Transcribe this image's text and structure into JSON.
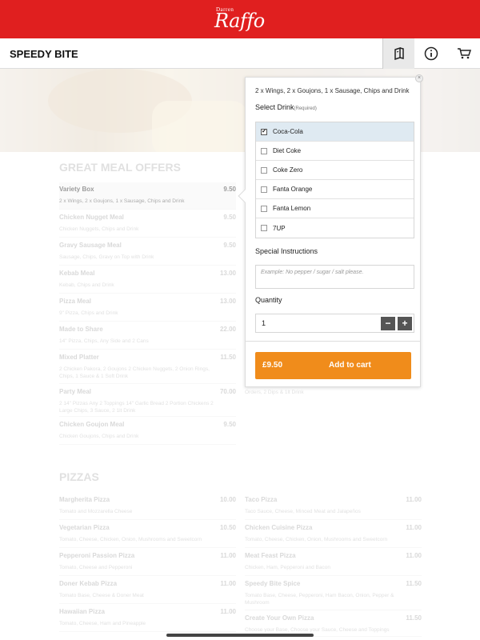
{
  "brand": {
    "small": "Darren",
    "name": "Raffo"
  },
  "navbar": {
    "title": "SPEEDY BITE"
  },
  "sections": {
    "meal_offers": {
      "title": "GREAT MEAL OFFERS",
      "items": [
        {
          "name": "Variety Box",
          "price": "9.50",
          "desc": "2 x Wings, 2 x Goujons, 1 x Sausage, Chips and Drink"
        },
        {
          "name": "Chicken Nugget Meal",
          "price": "9.50",
          "desc": "Chicken Nuggets, Chips and Drink"
        },
        {
          "name": "Gravy Sausage Meal",
          "price": "9.50",
          "desc": "Sausage, Chips, Gravy on Top with Drink"
        },
        {
          "name": "Kebab Meal",
          "price": "13.00",
          "desc": "Kebab, Chips and Drink"
        },
        {
          "name": "Pizza Meal",
          "price": "13.00",
          "desc": "9\" Pizza, Chips and Drink"
        },
        {
          "name": "Made to Share",
          "price": "22.00",
          "desc": "14\" Pizza, Chips, Any Side and 2 Cans"
        },
        {
          "name": "Mixed Platter",
          "price": "11.50",
          "desc": "2 Chicken Pakora, 2 Goujons 2 Chicken Nuggets, 2 Onion Rings, Chips, 1 Sauce & 1 Soft Drink"
        },
        {
          "name": "Party Meal",
          "price": "70.00",
          "desc": "2 14\" Pizzas Any 2 Toppings 14\" Garlic Bread 2 Portion Chickens 2 Large Chips, 3 Sauce, 2 1lt Drink"
        },
        {
          "name": "Chicken Goujon Meal",
          "price": "9.50",
          "desc": "Chicken Goujons, Chips and Drink"
        }
      ],
      "right_fragment": "Orders, 2 Dips & 1lt Drink"
    },
    "pizzas": {
      "title": "PIZZAS",
      "left": [
        {
          "name": "Margherita Pizza",
          "price": "10.00",
          "desc": "Tomato and Mozzarella Cheese"
        },
        {
          "name": "Vegetarian Pizza",
          "price": "10.50",
          "desc": "Tomato, Cheese, Chicken, Onion, Mushrooms and Sweetcorn"
        },
        {
          "name": "Pepperoni Passion Pizza",
          "price": "11.00",
          "desc": "Tomato, Cheese and Pepperoni"
        },
        {
          "name": "Doner Kebab Pizza",
          "price": "11.00",
          "desc": "Tomato Base, Cheese & Doner Meat"
        },
        {
          "name": "Hawaiian Pizza",
          "price": "11.00",
          "desc": "Tomato, Cheese, Ham and Pineapple"
        }
      ],
      "right": [
        {
          "name": "Taco Pizza",
          "price": "11.00",
          "desc": "Taco Sauce, Cheese, Minced Meat and Jalapeños"
        },
        {
          "name": "Chicken Cuisine Pizza",
          "price": "11.00",
          "desc": "Tomato, Cheese, Chicken, Onion, Mushrooms and Sweetcorn"
        },
        {
          "name": "Meat Feast Pizza",
          "price": "11.00",
          "desc": "Chicken, Ham, Pepperoni and Bacon"
        },
        {
          "name": "Speedy Bite Spice",
          "price": "11.50",
          "desc": "Tomato Base, Cheese, Pepperoni, Ham Bacon, Onion, Pepper & Mushroom"
        },
        {
          "name": "Create Your Own Pizza",
          "price": "11.50",
          "desc": "Choose your Base, Choose your Sauce, Cheese and Toppings"
        }
      ]
    }
  },
  "popup": {
    "description": "2 x Wings, 2 x Goujons, 1 x Sausage, Chips and Drink",
    "drink_label": "Select Drink",
    "required": "(Required)",
    "drinks": [
      "Coca-Cola",
      "Diet Coke",
      "Coke Zero",
      "Fanta Orange",
      "Fanta Lemon",
      "7UP"
    ],
    "selected_drink": "Coca-Cola",
    "special_label": "Special Instructions",
    "special_placeholder": "Example: No pepper / sugar / salt please.",
    "quantity_label": "Quantity",
    "quantity": "1",
    "minus": "−",
    "plus": "+",
    "total": "£9.50",
    "add_label": "Add to cart",
    "close": "×"
  },
  "colors": {
    "brand_red": "#e01f1f",
    "accent_orange": "#f08c1b"
  }
}
